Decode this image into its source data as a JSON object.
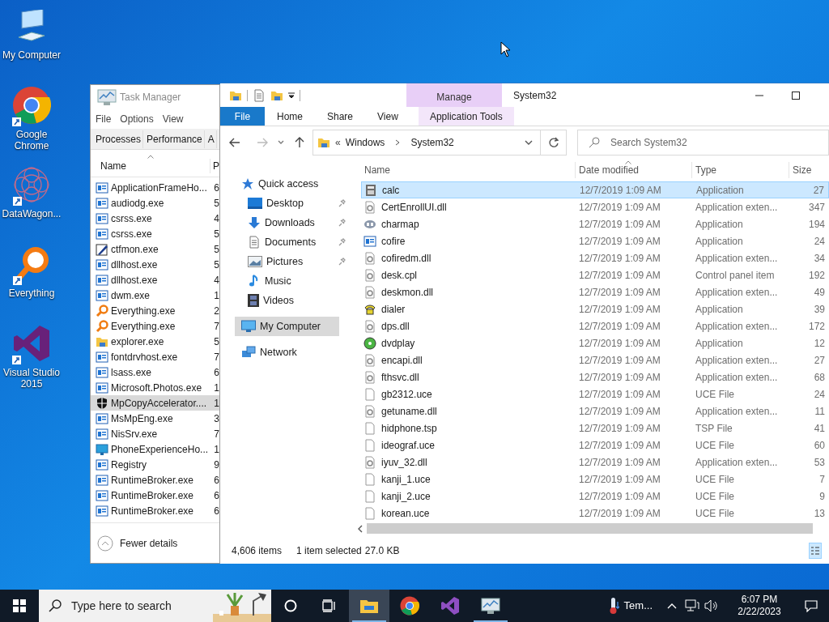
{
  "desktop_icons": [
    {
      "label": "My Computer",
      "kind": "computer",
      "shortcut": false
    },
    {
      "label": "Google Chrome",
      "kind": "chrome",
      "shortcut": true
    },
    {
      "label": "DataWagon...",
      "kind": "mandala",
      "shortcut": true
    },
    {
      "label": "Everything",
      "kind": "magnifier",
      "shortcut": true
    },
    {
      "label": "Visual Studio 2015",
      "kind": "vs",
      "shortcut": true
    }
  ],
  "task_manager": {
    "title": "Task Manager",
    "menu": [
      "File",
      "Options",
      "View"
    ],
    "tabs": [
      "Processes",
      "Performance",
      "A"
    ],
    "columns": [
      "Name",
      "P"
    ],
    "rows": [
      {
        "name": "ApplicationFrameHo...",
        "column_2": "6",
        "kind": "app",
        "selected": false
      },
      {
        "name": "audiodg.exe",
        "column_2": "5",
        "kind": "app",
        "selected": false
      },
      {
        "name": "csrss.exe",
        "column_2": "4",
        "kind": "app",
        "selected": false
      },
      {
        "name": "csrss.exe",
        "column_2": "5",
        "kind": "app",
        "selected": false
      },
      {
        "name": "ctfmon.exe",
        "column_2": "5",
        "kind": "pen",
        "selected": false
      },
      {
        "name": "dllhost.exe",
        "column_2": "5",
        "kind": "app",
        "selected": false
      },
      {
        "name": "dllhost.exe",
        "column_2": "4",
        "kind": "app",
        "selected": false
      },
      {
        "name": "dwm.exe",
        "column_2": "1",
        "kind": "app",
        "selected": false
      },
      {
        "name": "Everything.exe",
        "column_2": "2",
        "kind": "magnifier",
        "selected": false
      },
      {
        "name": "Everything.exe",
        "column_2": "7",
        "kind": "magnifier",
        "selected": false
      },
      {
        "name": "explorer.exe",
        "column_2": "5",
        "kind": "folder",
        "selected": false
      },
      {
        "name": "fontdrvhost.exe",
        "column_2": "7",
        "kind": "app",
        "selected": false
      },
      {
        "name": "lsass.exe",
        "column_2": "6",
        "kind": "app",
        "selected": false
      },
      {
        "name": "Microsoft.Photos.exe",
        "column_2": "1",
        "kind": "app",
        "selected": false
      },
      {
        "name": "MpCopyAccelerator....",
        "column_2": "1",
        "kind": "shield",
        "selected": true
      },
      {
        "name": "MsMpEng.exe",
        "column_2": "3",
        "kind": "app",
        "selected": false
      },
      {
        "name": "NisSrv.exe",
        "column_2": "7",
        "kind": "app",
        "selected": false
      },
      {
        "name": "PhoneExperienceHo...",
        "column_2": "1",
        "kind": "monitor",
        "selected": false
      },
      {
        "name": "Registry",
        "column_2": "9",
        "kind": "app",
        "selected": false
      },
      {
        "name": "RuntimeBroker.exe",
        "column_2": "6",
        "kind": "app",
        "selected": false
      },
      {
        "name": "RuntimeBroker.exe",
        "column_2": "6",
        "kind": "app",
        "selected": false
      },
      {
        "name": "RuntimeBroker.exe",
        "column_2": "6",
        "kind": "app",
        "selected": false
      }
    ],
    "footer": "Fewer details"
  },
  "explorer": {
    "title": "System32",
    "context_tab": "Manage",
    "ribbon_tabs": [
      {
        "label": "File",
        "kind": "file"
      },
      {
        "label": "Home",
        "kind": "tab"
      },
      {
        "label": "Share",
        "kind": "tab"
      },
      {
        "label": "View",
        "kind": "tab"
      },
      {
        "label": "Application Tools",
        "kind": "context"
      }
    ],
    "address": {
      "overflow": "«",
      "path": [
        "Windows",
        "System32"
      ]
    },
    "search": {
      "placeholder": "Search System32"
    },
    "nav": [
      {
        "label": "Quick access",
        "kind": "star",
        "selected": false,
        "children": [
          {
            "label": "Desktop",
            "kind": "desktop",
            "pinned": true,
            "selected": false
          },
          {
            "label": "Downloads",
            "kind": "download",
            "pinned": true,
            "selected": false
          },
          {
            "label": "Documents",
            "kind": "document",
            "pinned": true,
            "selected": false
          },
          {
            "label": "Pictures",
            "kind": "pictures",
            "pinned": true,
            "selected": false
          },
          {
            "label": "Music",
            "kind": "music",
            "pinned": false,
            "selected": false
          },
          {
            "label": "Videos",
            "kind": "videos",
            "pinned": false,
            "selected": false
          }
        ]
      },
      {
        "label": "My Computer",
        "kind": "computer",
        "selected": true
      },
      {
        "label": "Network",
        "kind": "network",
        "selected": false
      }
    ],
    "columns": [
      "Name",
      "Date modified",
      "Type",
      "Size"
    ],
    "rows": [
      {
        "name": "calc",
        "date": "12/7/2019 1:09 AM",
        "type": "Application",
        "size": "27",
        "kind": "calculator",
        "selected": true
      },
      {
        "name": "CertEnrollUI.dll",
        "date": "12/7/2019 1:09 AM",
        "type": "Application exten...",
        "size": "347",
        "kind": "dll",
        "selected": false
      },
      {
        "name": "charmap",
        "date": "12/7/2019 1:09 AM",
        "type": "Application",
        "size": "194",
        "kind": "charmap",
        "selected": false
      },
      {
        "name": "cofire",
        "date": "12/7/2019 1:09 AM",
        "type": "Application",
        "size": "24",
        "kind": "app",
        "selected": false
      },
      {
        "name": "cofiredm.dll",
        "date": "12/7/2019 1:09 AM",
        "type": "Application exten...",
        "size": "34",
        "kind": "dll",
        "selected": false
      },
      {
        "name": "desk.cpl",
        "date": "12/7/2019 1:09 AM",
        "type": "Control panel item",
        "size": "192",
        "kind": "dll",
        "selected": false
      },
      {
        "name": "deskmon.dll",
        "date": "12/7/2019 1:09 AM",
        "type": "Application exten...",
        "size": "49",
        "kind": "dll",
        "selected": false
      },
      {
        "name": "dialer",
        "date": "12/7/2019 1:09 AM",
        "type": "Application",
        "size": "39",
        "kind": "phone",
        "selected": false
      },
      {
        "name": "dps.dll",
        "date": "12/7/2019 1:09 AM",
        "type": "Application exten...",
        "size": "172",
        "kind": "dll",
        "selected": false
      },
      {
        "name": "dvdplay",
        "date": "12/7/2019 1:09 AM",
        "type": "Application",
        "size": "12",
        "kind": "disc",
        "selected": false
      },
      {
        "name": "encapi.dll",
        "date": "12/7/2019 1:09 AM",
        "type": "Application exten...",
        "size": "27",
        "kind": "dll",
        "selected": false
      },
      {
        "name": "fthsvc.dll",
        "date": "12/7/2019 1:09 AM",
        "type": "Application exten...",
        "size": "68",
        "kind": "dll",
        "selected": false
      },
      {
        "name": "gb2312.uce",
        "date": "12/7/2019 1:09 AM",
        "type": "UCE File",
        "size": "24",
        "kind": "file",
        "selected": false
      },
      {
        "name": "getuname.dll",
        "date": "12/7/2019 1:09 AM",
        "type": "Application exten...",
        "size": "11",
        "kind": "dll",
        "selected": false
      },
      {
        "name": "hidphone.tsp",
        "date": "12/7/2019 1:09 AM",
        "type": "TSP File",
        "size": "41",
        "kind": "file",
        "selected": false
      },
      {
        "name": "ideograf.uce",
        "date": "12/7/2019 1:09 AM",
        "type": "UCE File",
        "size": "60",
        "kind": "file",
        "selected": false
      },
      {
        "name": "iyuv_32.dll",
        "date": "12/7/2019 1:09 AM",
        "type": "Application exten...",
        "size": "53",
        "kind": "dll",
        "selected": false
      },
      {
        "name": "kanji_1.uce",
        "date": "12/7/2019 1:09 AM",
        "type": "UCE File",
        "size": "7",
        "kind": "file",
        "selected": false
      },
      {
        "name": "kanji_2.uce",
        "date": "12/7/2019 1:09 AM",
        "type": "UCE File",
        "size": "9",
        "kind": "file",
        "selected": false
      },
      {
        "name": "korean.uce",
        "date": "12/7/2019 1:09 AM",
        "type": "UCE File",
        "size": "13",
        "kind": "file",
        "selected": false
      }
    ],
    "status": {
      "count": "4,606 items",
      "selection": "1 item selected",
      "size": "27.0 KB"
    }
  },
  "taskbar": {
    "search": {
      "placeholder": "Type here to search"
    },
    "apps": [
      {
        "kind": "explorer",
        "active": true,
        "running": true
      },
      {
        "kind": "chrome",
        "active": false,
        "running": false
      },
      {
        "kind": "vs",
        "active": false,
        "running": false
      },
      {
        "kind": "taskmgr",
        "active": false,
        "running": true
      }
    ],
    "weather": "Tem...",
    "time": "6:07 PM",
    "date": "2/22/2023"
  }
}
